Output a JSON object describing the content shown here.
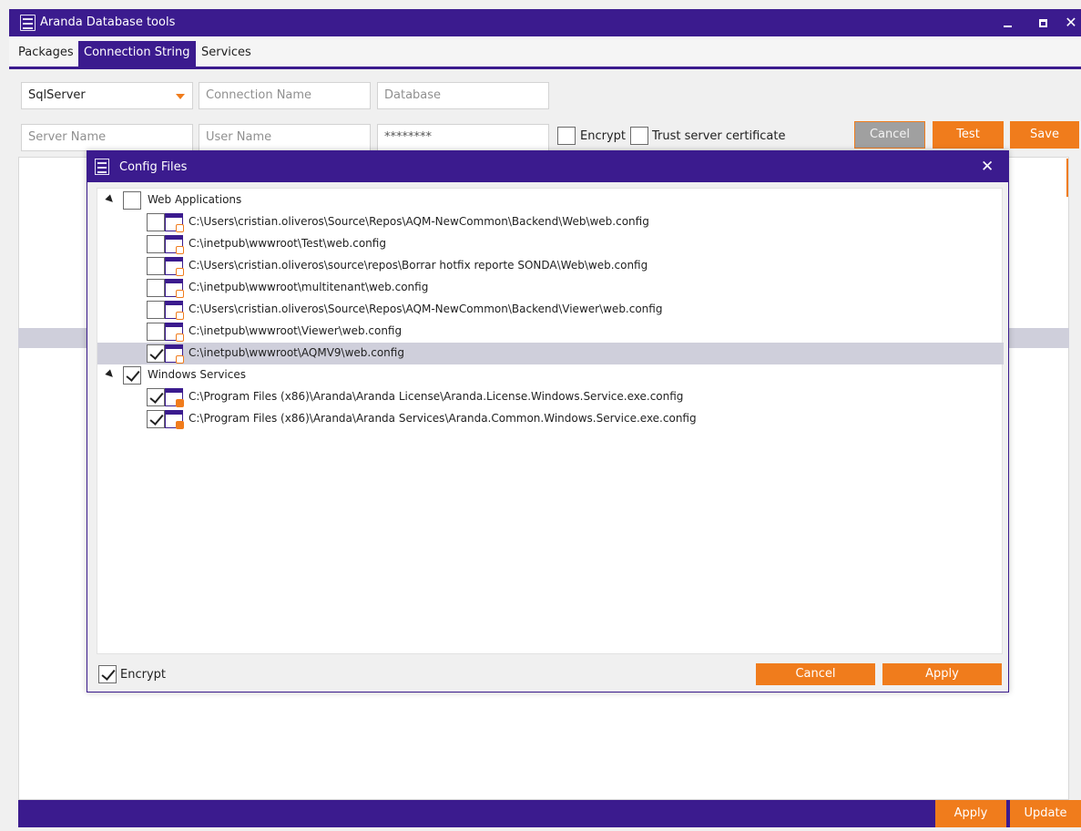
{
  "window": {
    "title": "Aranda Database tools"
  },
  "tabs": [
    {
      "label": "Packages"
    },
    {
      "label": "Connection String"
    },
    {
      "label": "Services"
    }
  ],
  "form": {
    "provider_value": "SqlServer",
    "connection_name_placeholder": "Connection Name",
    "database_placeholder": "Database",
    "server_name_placeholder": "Server Name",
    "user_name_placeholder": "User Name",
    "password_value": "********",
    "encrypt_label": "Encrypt",
    "trust_label": "Trust server certificate",
    "cancel_label": "Cancel",
    "test_label": "Test",
    "save_label": "Save"
  },
  "statusbar": {
    "apply_label": "Apply",
    "update_label": "Update"
  },
  "dialog": {
    "title": "Config Files",
    "groups": [
      {
        "label": "Web Applications",
        "checked": false,
        "items": [
          {
            "path": "C:\\Users\\cristian.oliveros\\Source\\Repos\\AQM-NewCommon\\Backend\\Web\\web.config",
            "checked": false
          },
          {
            "path": "C:\\inetpub\\wwwroot\\Test\\web.config",
            "checked": false
          },
          {
            "path": "C:\\Users\\cristian.oliveros\\source\\repos\\Borrar hotfix reporte SONDA\\Web\\web.config",
            "checked": false
          },
          {
            "path": "C:\\inetpub\\wwwroot\\multitenant\\web.config",
            "checked": false
          },
          {
            "path": "C:\\Users\\cristian.oliveros\\Source\\Repos\\AQM-NewCommon\\Backend\\Viewer\\web.config",
            "checked": false
          },
          {
            "path": "C:\\inetpub\\wwwroot\\Viewer\\web.config",
            "checked": false
          },
          {
            "path": "C:\\inetpub\\wwwroot\\AQMV9\\web.config",
            "checked": true
          }
        ]
      },
      {
        "label": "Windows Services",
        "checked": true,
        "items": [
          {
            "path": "C:\\Program Files (x86)\\Aranda\\Aranda License\\Aranda.License.Windows.Service.exe.config",
            "checked": true
          },
          {
            "path": "C:\\Program Files (x86)\\Aranda\\Aranda Services\\Aranda.Common.Windows.Service.exe.config",
            "checked": true
          }
        ]
      }
    ],
    "encrypt_label": "Encrypt",
    "cancel_label": "Cancel",
    "apply_label": "Apply"
  },
  "colors": {
    "brand": "#3b1b8e",
    "accent": "#f07c1c",
    "selected_row": "#cfcfdb"
  }
}
